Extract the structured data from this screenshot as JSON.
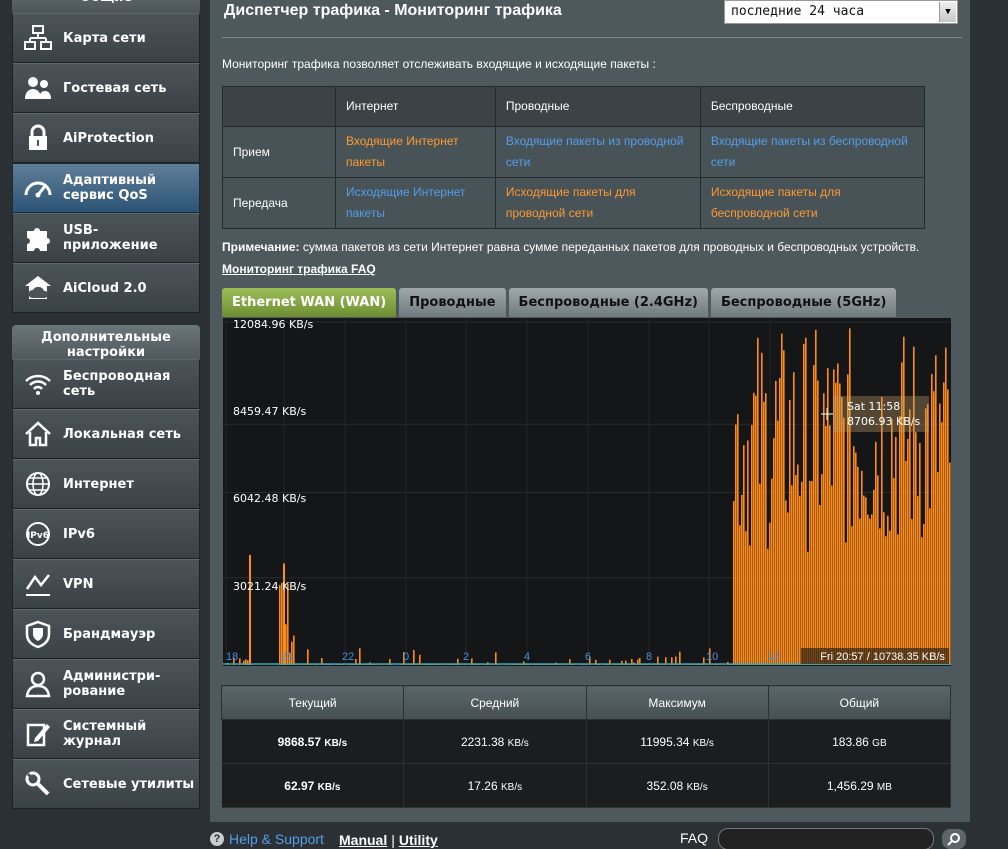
{
  "sidebar": {
    "group_top_label": "Общие",
    "general_items": [
      {
        "label": "Карта сети",
        "icon": "network-map-icon"
      },
      {
        "label": "Гостевая сеть",
        "icon": "guest-network-icon"
      },
      {
        "label": "AiProtection",
        "icon": "lock-icon"
      },
      {
        "label": "Адаптивный\nсервис QoS",
        "icon": "speedometer-icon",
        "active": true
      },
      {
        "label": "USB-\nприложение",
        "icon": "puzzle-icon"
      },
      {
        "label": "AiCloud 2.0",
        "icon": "cloud-icon"
      }
    ],
    "advanced_header": "Дополнительные\nнастройки",
    "advanced_items": [
      {
        "label": "Беспроводная\nсеть",
        "icon": "wifi-icon"
      },
      {
        "label": "Локальная сеть",
        "icon": "home-icon"
      },
      {
        "label": "Интернет",
        "icon": "globe-icon"
      },
      {
        "label": "IPv6",
        "icon": "ipv6-icon"
      },
      {
        "label": "VPN",
        "icon": "vpn-icon"
      },
      {
        "label": "Брандмауэр",
        "icon": "shield-icon"
      },
      {
        "label": "Администри-\nрование",
        "icon": "user-icon"
      },
      {
        "label": "Системный\nжурнал",
        "icon": "log-icon"
      },
      {
        "label": "Сетевые утилиты",
        "icon": "tools-icon"
      }
    ]
  },
  "header": {
    "title": "Диспетчер трафика - Мониторинг трафика",
    "range_selected": "последние 24 часа"
  },
  "intro": "Мониторинг трафика позволяет отслеживать входящие и исходящие пакеты :",
  "packet_table": {
    "columns": [
      "Интернет",
      "Проводные",
      "Беспроводные"
    ],
    "rows": [
      {
        "label": "Прием",
        "cells": [
          "Входящие Интернет пакеты",
          "Входящие пакеты из проводной сети",
          "Входящие пакеты из беспроводной сети"
        ]
      },
      {
        "label": "Передача",
        "cells": [
          "Исходящие Интернет пакеты",
          "Исходящие пакеты для проводной сети",
          "Исходящие пакеты для беспроводной сети"
        ]
      }
    ]
  },
  "note": {
    "bold": "Примечание:",
    "text": " сумма пакетов из сети Интернет равна сумме переданных пакетов для проводных и беспроводных устройств."
  },
  "faq_link": "Мониторинг трафика FAQ",
  "tabs": [
    "Ethernet WAN (WAN)",
    "Проводные",
    "Беспроводные (2.4GHz)",
    "Беспроводные (5GHz)"
  ],
  "chart_data": {
    "type": "area",
    "y_tick_labels": [
      "12084.96 KB/s",
      "8459.47 KB/s",
      "6042.48 KB/s",
      "3021.24 KB/s"
    ],
    "x_tick_labels": [
      "18",
      "20",
      "22",
      "0",
      "2",
      "4",
      "6",
      "8",
      "10",
      "12"
    ],
    "ylim": [
      0,
      12084.96
    ],
    "hover_label_time": "Sat 11:58",
    "hover_label_value": "8706.93 KB/s",
    "status_text": "Fri 20:57 / 10738.35 KB/s",
    "series": [
      {
        "color": "#ff8c1a"
      },
      {
        "color": "#3aa6b9"
      }
    ],
    "colors": {
      "rx": "#ff8c1a",
      "tx": "#3aa6b9"
    }
  },
  "stats": {
    "headers": [
      "Текущий",
      "Средний",
      "Максимум",
      "Общий"
    ],
    "rx": [
      {
        "value": "9868.57",
        "unit": "KB/s"
      },
      {
        "value": "2231.38",
        "unit": "KB/s"
      },
      {
        "value": "11995.34",
        "unit": "KB/s"
      },
      {
        "value": "183.86",
        "unit": "GB"
      }
    ],
    "tx": [
      {
        "value": "62.97",
        "unit": "KB/s"
      },
      {
        "value": "17.26",
        "unit": "KB/s"
      },
      {
        "value": "352.08",
        "unit": "KB/s"
      },
      {
        "value": "1,456.29",
        "unit": "MB"
      }
    ]
  },
  "footer": {
    "help": "Help & Support",
    "manual": "Manual",
    "separator": "|",
    "utility": "Utility",
    "faq_label": "FAQ"
  }
}
